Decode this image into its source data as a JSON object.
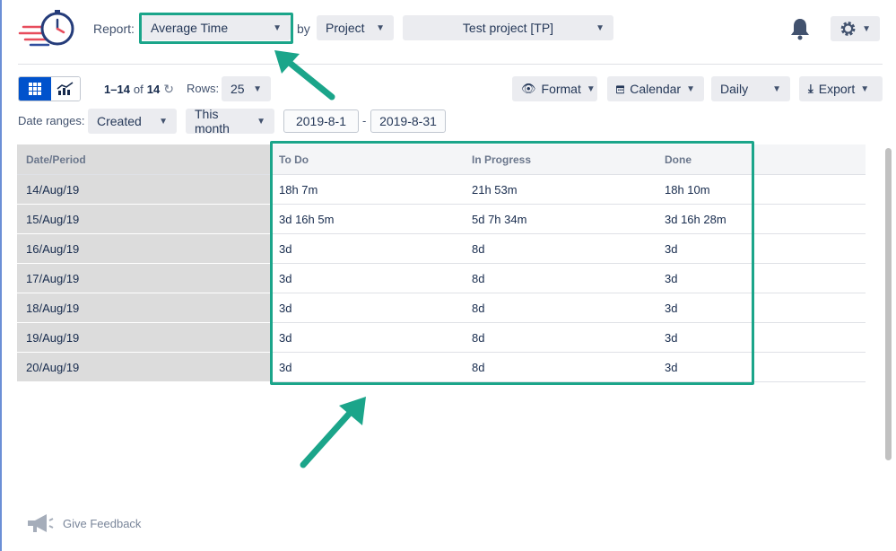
{
  "header": {
    "report_label": "Report:",
    "report_value": "Average Time",
    "by_label": "by",
    "group_value": "Project",
    "project_value": "Test project [TP]"
  },
  "toolbar": {
    "pagination": "1–14",
    "of_label": "of",
    "total": "14",
    "rows_label": "Rows:",
    "rows_value": "25",
    "format_label": "Format",
    "calendar_label": "Calendar",
    "daily_label": "Daily",
    "export_label": "Export"
  },
  "filters": {
    "date_ranges_label": "Date ranges:",
    "field_value": "Created",
    "period_value": "This month",
    "date_from": "2019-8-1",
    "date_sep": "-",
    "date_to": "2019-8-31"
  },
  "table": {
    "columns": [
      "Date/Period",
      "To Do",
      "In Progress",
      "Done"
    ],
    "rows": [
      [
        "14/Aug/19",
        "18h 7m",
        "21h 53m",
        "18h 10m"
      ],
      [
        "15/Aug/19",
        "3d 16h 5m",
        "5d 7h 34m",
        "3d 16h 28m"
      ],
      [
        "16/Aug/19",
        "3d",
        "8d",
        "3d"
      ],
      [
        "17/Aug/19",
        "3d",
        "8d",
        "3d"
      ],
      [
        "18/Aug/19",
        "3d",
        "8d",
        "3d"
      ],
      [
        "19/Aug/19",
        "3d",
        "8d",
        "3d"
      ],
      [
        "20/Aug/19",
        "3d",
        "8d",
        "3d"
      ]
    ]
  },
  "footer": {
    "feedback_label": "Give Feedback"
  },
  "colors": {
    "accent": "#1ba58a",
    "primary": "#0052cc"
  }
}
